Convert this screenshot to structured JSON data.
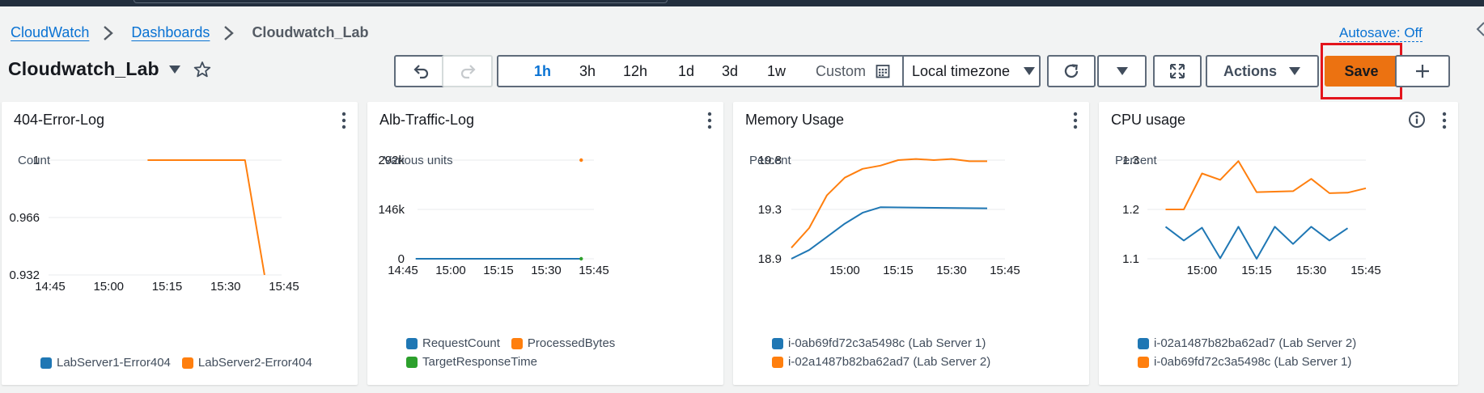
{
  "breadcrumb": {
    "cloudwatch": "CloudWatch",
    "dashboards": "Dashboards",
    "current": "Cloudwatch_Lab"
  },
  "autosave": "Autosave: Off",
  "dashboard": {
    "title": "Cloudwatch_Lab"
  },
  "toolbar": {
    "undo_icon": "undo-icon",
    "redo_icon": "redo-icon",
    "ranges": [
      "1h",
      "3h",
      "12h",
      "1d",
      "3d",
      "1w"
    ],
    "selected_range": "1h",
    "custom_label": "Custom",
    "timezone": "Local timezone",
    "actions_label": "Actions",
    "save_label": "Save"
  },
  "colors": {
    "blue": "#1f77b4",
    "orange": "#ff7f0e",
    "green": "#2ca02c",
    "save": "#ec7211",
    "link": "#0972d3",
    "highlight": "#e3141c"
  },
  "widgets": [
    {
      "title": "404-Error-Log",
      "units": "Count",
      "legend": [
        "LabServer1-Error404",
        "LabServer2-Error404"
      ]
    },
    {
      "title": "Alb-Traffic-Log",
      "units": "Various units",
      "legend": [
        "RequestCount",
        "ProcessedBytes",
        "TargetResponseTime"
      ]
    },
    {
      "title": "Memory Usage",
      "units": "Percent",
      "legend": [
        "i-0ab69fd72c3a5498c (Lab Server 1)",
        "i-02a1487b82ba62ad7 (Lab Server 2)"
      ]
    },
    {
      "title": "CPU usage",
      "units": "Percent",
      "legend": [
        "i-02a1487b82ba62ad7 (Lab Server 2)",
        "i-0ab69fd72c3a5498c (Lab Server 1)"
      ]
    }
  ],
  "chart_data": [
    {
      "type": "line",
      "title": "404-Error-Log",
      "ylabel": "Count",
      "x_ticks": [
        "14:45",
        "15:00",
        "15:15",
        "15:30",
        "15:45"
      ],
      "y_ticks": [
        "0.932",
        "0.966",
        "1"
      ],
      "ylim": [
        0.932,
        1
      ],
      "xlim": [
        "14:45",
        "15:45"
      ],
      "grid": true,
      "legend_position": "bottom",
      "series": [
        {
          "name": "LabServer1-Error404",
          "color": "#1f77b4",
          "x": [],
          "y": []
        },
        {
          "name": "LabServer2-Error404",
          "color": "#ff7f0e",
          "x": [
            "15:10",
            "15:15",
            "15:20",
            "15:25",
            "15:35",
            "15:40"
          ],
          "y": [
            1,
            1,
            1,
            1,
            1,
            0.932
          ]
        }
      ]
    },
    {
      "type": "line",
      "title": "Alb-Traffic-Log",
      "ylabel": "Various units",
      "x_ticks": [
        "14:45",
        "15:00",
        "15:15",
        "15:30",
        "15:45"
      ],
      "y_ticks": [
        "0",
        "146k",
        "292k"
      ],
      "ylim": [
        0,
        292000
      ],
      "xlim": [
        "14:45",
        "15:45"
      ],
      "grid": true,
      "legend_position": "bottom",
      "series": [
        {
          "name": "RequestCount",
          "color": "#1f77b4",
          "x": [
            "14:49",
            "15:41"
          ],
          "y": [
            0,
            0
          ]
        },
        {
          "name": "ProcessedBytes",
          "color": "#ff7f0e",
          "x": [
            "15:41"
          ],
          "y": [
            292000
          ]
        },
        {
          "name": "TargetResponseTime",
          "color": "#2ca02c",
          "x": [
            "15:41"
          ],
          "y": [
            0
          ]
        }
      ]
    },
    {
      "type": "line",
      "title": "Memory Usage",
      "ylabel": "Percent",
      "x_ticks": [
        "15:00",
        "15:15",
        "15:30",
        "15:45"
      ],
      "y_ticks": [
        "18.9",
        "19.3",
        "19.8"
      ],
      "ylim": [
        18.9,
        19.8
      ],
      "xlim": [
        "14:45",
        "15:45"
      ],
      "grid": true,
      "legend_position": "bottom",
      "series": [
        {
          "name": "i-0ab69fd72c3a5498c (Lab Server 1)",
          "color": "#1f77b4",
          "x": [
            "14:45",
            "14:50",
            "14:55",
            "15:00",
            "15:05",
            "15:10",
            "15:40"
          ],
          "y": [
            18.9,
            18.98,
            19.1,
            19.22,
            19.32,
            19.37,
            19.36
          ]
        },
        {
          "name": "i-02a1487b82ba62ad7 (Lab Server 2)",
          "color": "#ff7f0e",
          "x": [
            "14:45",
            "14:50",
            "14:55",
            "15:00",
            "15:05",
            "15:10",
            "15:15",
            "15:20",
            "15:25",
            "15:30",
            "15:35",
            "15:40"
          ],
          "y": [
            19.0,
            19.18,
            19.48,
            19.64,
            19.72,
            19.75,
            19.8,
            19.81,
            19.8,
            19.81,
            19.79,
            19.79
          ]
        }
      ]
    },
    {
      "type": "line",
      "title": "CPU usage",
      "ylabel": "Percent",
      "x_ticks": [
        "15:00",
        "15:15",
        "15:30",
        "15:45"
      ],
      "y_ticks": [
        "1.1",
        "1.2",
        "1.3"
      ],
      "ylim": [
        1.1,
        1.3
      ],
      "xlim": [
        "14:45",
        "15:45"
      ],
      "grid": true,
      "legend_position": "bottom",
      "series": [
        {
          "name": "i-02a1487b82ba62ad7 (Lab Server 2)",
          "color": "#1f77b4",
          "x": [
            "14:50",
            "14:55",
            "15:00",
            "15:05",
            "15:10",
            "15:15",
            "15:20",
            "15:25",
            "15:30",
            "15:35",
            "15:40"
          ],
          "y": [
            1.165,
            1.137,
            1.163,
            1.101,
            1.165,
            1.1,
            1.165,
            1.13,
            1.165,
            1.137,
            1.162
          ]
        },
        {
          "name": "i-0ab69fd72c3a5498c (Lab Server 1)",
          "color": "#ff7f0e",
          "x": [
            "14:50",
            "14:55",
            "15:00",
            "15:05",
            "15:10",
            "15:15",
            "15:20",
            "15:25",
            "15:30",
            "15:35",
            "15:40",
            "15:45"
          ],
          "y": [
            1.2,
            1.2,
            1.273,
            1.26,
            1.298,
            1.235,
            1.236,
            1.237,
            1.262,
            1.233,
            1.234,
            1.243
          ]
        }
      ]
    }
  ]
}
